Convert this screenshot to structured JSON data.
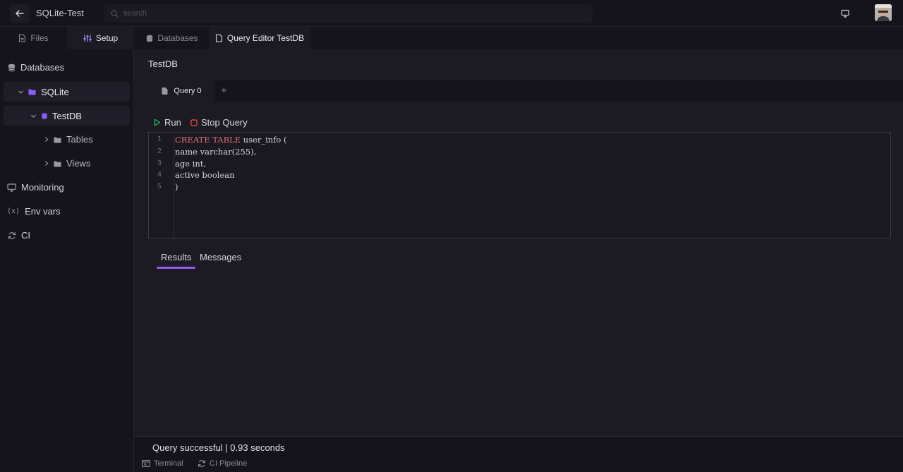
{
  "app": {
    "title": "SQLite-Test"
  },
  "search": {
    "placeholder": "search"
  },
  "left_tabs": [
    {
      "label": "Files",
      "icon": "file-icon"
    },
    {
      "label": "Setup",
      "icon": "sliders-icon"
    }
  ],
  "sidebar": {
    "databases": "Databases",
    "sqlite": "SQLite",
    "testdb": "TestDB",
    "tables": "Tables",
    "views": "Views",
    "monitoring": "Monitoring",
    "env_vars": "Env vars",
    "env_icon": "(x)",
    "ci": "CI"
  },
  "main_tabs": [
    {
      "label": "Databases",
      "icon": "database-icon"
    },
    {
      "label": "Query Editor TestDB",
      "icon": "file-icon"
    }
  ],
  "editor": {
    "db_title": "TestDB",
    "query_tab": "Query 0",
    "add_tab": "+",
    "run_label": "Run",
    "stop_label": "Stop Query",
    "line_numbers": [
      "1",
      "2",
      "3",
      "4",
      "5"
    ],
    "lines": [
      {
        "keyword": "CREATE TABLE",
        "rest": " user_info ("
      },
      {
        "keyword": "",
        "rest": "name varchar(255),"
      },
      {
        "keyword": "",
        "rest": "age int,"
      },
      {
        "keyword": "",
        "rest": "active boolean"
      },
      {
        "keyword": "",
        "rest": ")"
      }
    ]
  },
  "results": {
    "tabs": [
      "Results",
      "Messages"
    ],
    "active_tab": "Results"
  },
  "status": {
    "text": "Query successful | 0.93 seconds"
  },
  "bottom_tabs": [
    {
      "label": "Terminal",
      "icon": "terminal-icon"
    },
    {
      "label": "CI Pipeline",
      "icon": "refresh-icon"
    }
  ],
  "colors": {
    "accent": "#8b5cf6",
    "keyword": "#e06c75",
    "run_icon": "#22c55e",
    "stop_icon": "#ef4444",
    "folder": "#8b5cf6"
  }
}
